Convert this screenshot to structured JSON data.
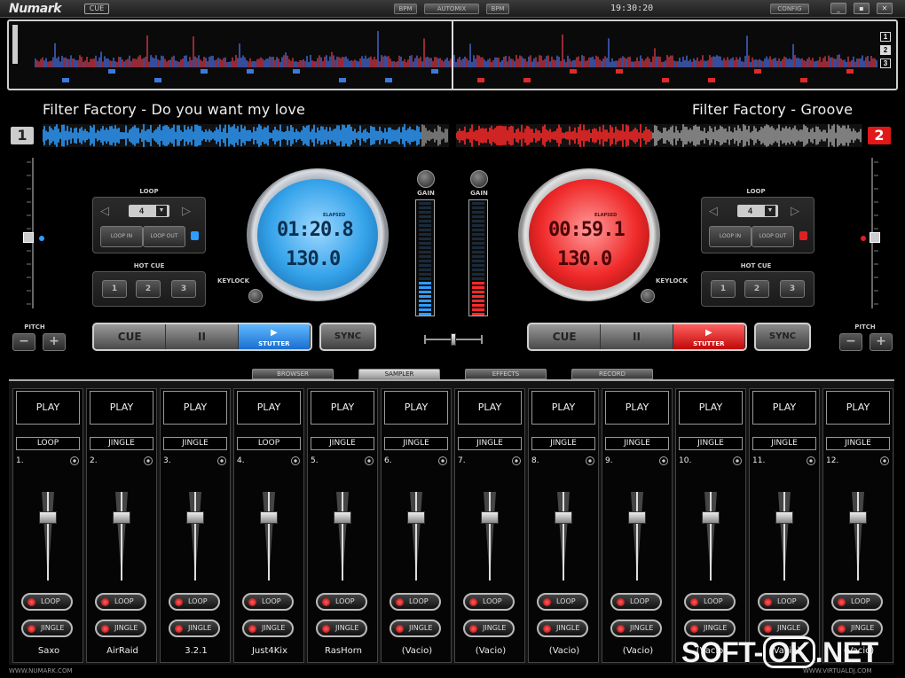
{
  "app": {
    "brand": "Numark",
    "badge": "CUE"
  },
  "topbar": {
    "bpm_left": "BPM",
    "automix": "AUTOMIX",
    "bpm_right": "BPM",
    "clock": "19:30:20",
    "config": "CONFIG"
  },
  "overview": {
    "markers": [
      "1",
      "2",
      "3"
    ]
  },
  "deck1": {
    "number": "1",
    "title": "Filter Factory - Do you want my love",
    "loop_label": "LOOP",
    "loop_value": "4",
    "loop_in": "LOOP IN",
    "loop_out": "LOOP OUT",
    "hotcue_label": "HOT CUE",
    "hotcues": [
      "1",
      "2",
      "3"
    ],
    "time_label": "ELAPSED",
    "time": "01:20.8",
    "bpm": "130.0",
    "keylock": "KEYLOCK",
    "pitch": "PITCH",
    "pitch_minus": "−",
    "pitch_plus": "+",
    "cue": "CUE",
    "pause": "II",
    "play": "STUTTER",
    "sync": "SYNC",
    "color": "#2f9cff"
  },
  "deck2": {
    "number": "2",
    "title": "Filter Factory - Groove",
    "loop_label": "LOOP",
    "loop_value": "4",
    "loop_in": "LOOP IN",
    "loop_out": "LOOP OUT",
    "hotcue_label": "HOT CUE",
    "hotcues": [
      "1",
      "2",
      "3"
    ],
    "time_label": "ELAPSED",
    "time": "00:59.1",
    "bpm": "130.0",
    "keylock": "KEYLOCK",
    "pitch": "PITCH",
    "pitch_minus": "−",
    "pitch_plus": "+",
    "cue": "CUE",
    "pause": "II",
    "play": "STUTTER",
    "sync": "SYNC",
    "color": "#ff2a2a"
  },
  "mixer": {
    "gain_left": "GAIN",
    "gain_right": "GAIN"
  },
  "tabs": [
    "BROWSER",
    "SAMPLER",
    "EFFECTS",
    "RECORD"
  ],
  "active_tab": "SAMPLER",
  "sampler": {
    "play_label": "PLAY",
    "loop_btn": "LOOP",
    "jingle_btn": "JINGLE",
    "slots": [
      {
        "num": "1.",
        "type": "LOOP",
        "name": "Saxo"
      },
      {
        "num": "2.",
        "type": "JINGLE",
        "name": "AirRaid"
      },
      {
        "num": "3.",
        "type": "JINGLE",
        "name": "3.2.1"
      },
      {
        "num": "4.",
        "type": "LOOP",
        "name": "Just4Kix"
      },
      {
        "num": "5.",
        "type": "JINGLE",
        "name": "RasHorn"
      },
      {
        "num": "6.",
        "type": "JINGLE",
        "name": "(Vacio)"
      },
      {
        "num": "7.",
        "type": "JINGLE",
        "name": "(Vacio)"
      },
      {
        "num": "8.",
        "type": "JINGLE",
        "name": "(Vacio)"
      },
      {
        "num": "9.",
        "type": "JINGLE",
        "name": "(Vacio)"
      },
      {
        "num": "10.",
        "type": "JINGLE",
        "name": "(Vacio)"
      },
      {
        "num": "11.",
        "type": "JINGLE",
        "name": "(Vacio)"
      },
      {
        "num": "12.",
        "type": "JINGLE",
        "name": "(Vacio)"
      }
    ]
  },
  "footer": {
    "left": "WWW.NUMARK.COM",
    "right": "WWW.VIRTUALDJ.COM"
  },
  "watermark": {
    "pre": "SOFT-",
    "mid": "OK",
    "post": ".NET"
  }
}
